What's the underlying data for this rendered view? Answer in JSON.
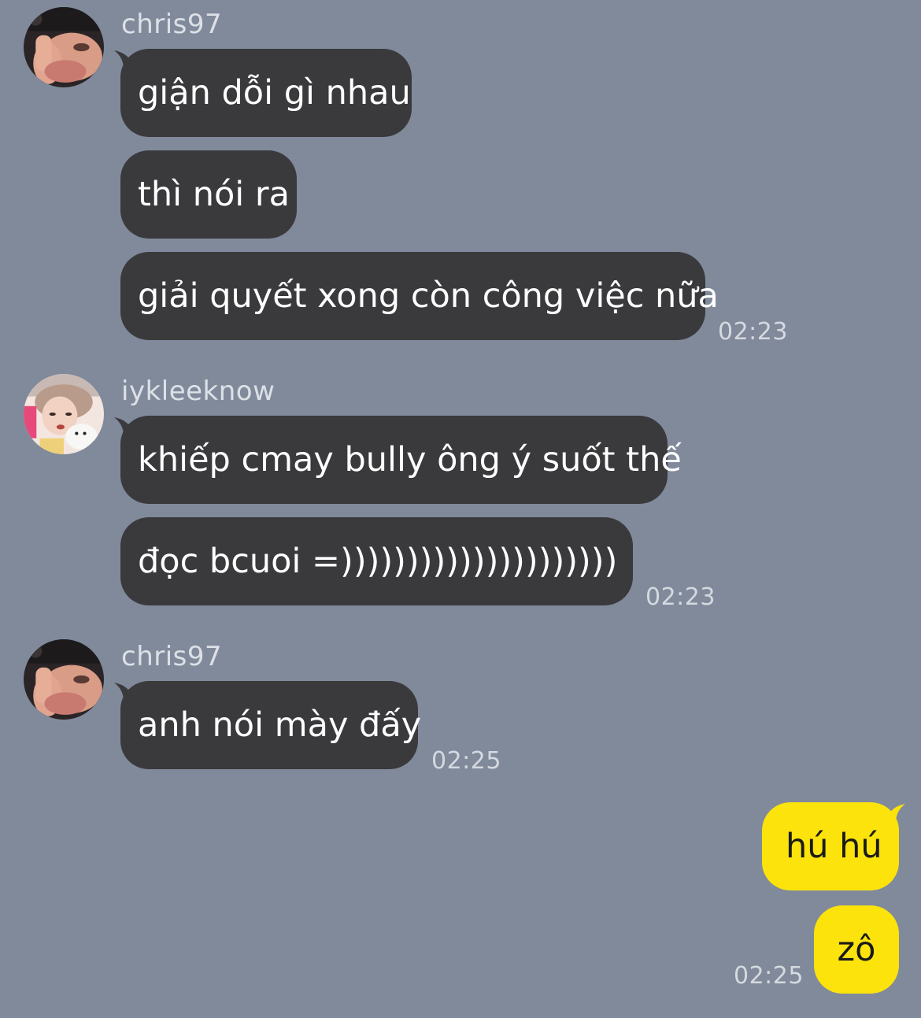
{
  "messages": {
    "group1": {
      "sender": "chris97",
      "lines": [
        "giận dỗi gì nhau",
        "thì nói ra",
        "giải quyết xong còn công việc nữa"
      ],
      "time": "02:23"
    },
    "group2": {
      "sender": "iykleeknow",
      "lines": [
        "khiếp cmay bully ông ý suốt thế",
        "đọc bcuoi =)))))))))))))))))))))"
      ],
      "time": "02:23"
    },
    "group3": {
      "sender": "chris97",
      "lines": [
        "anh nói mày đấy"
      ],
      "time": "02:25"
    },
    "outgoing": {
      "lines": [
        "hú hú",
        "zô"
      ],
      "time": "02:25"
    }
  },
  "colors": {
    "background": "#808a9b",
    "incoming_bubble": "#3a3a3c",
    "outgoing_bubble": "#fbe30b"
  },
  "icons": {
    "avatar1": "user-avatar-photo",
    "avatar2": "user-avatar-photo-with-cat",
    "avatar3": "user-avatar-photo"
  }
}
